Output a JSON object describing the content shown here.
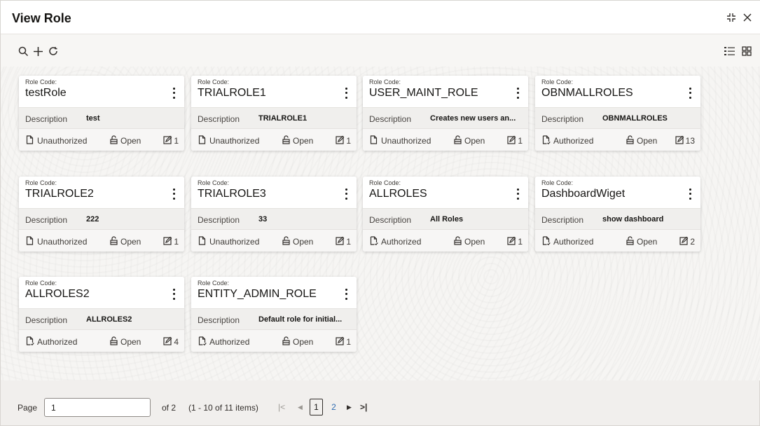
{
  "header": {
    "title": "View Role"
  },
  "toolbar": {},
  "cards": [
    {
      "rc_label": "Role Code:",
      "code": "testRole",
      "desc_label": "Description",
      "desc": "test",
      "status": "Unauthorized",
      "lock": "Open",
      "count": "1"
    },
    {
      "rc_label": "Role Code:",
      "code": "TRIALROLE1",
      "desc_label": "Description",
      "desc": "TRIALROLE1",
      "status": "Unauthorized",
      "lock": "Open",
      "count": "1"
    },
    {
      "rc_label": "Role Code:",
      "code": "USER_MAINT_ROLE",
      "desc_label": "Description",
      "desc": "Creates new users an...",
      "status": "Unauthorized",
      "lock": "Open",
      "count": "1"
    },
    {
      "rc_label": "Role Code:",
      "code": "OBNMALLROLES",
      "desc_label": "Description",
      "desc": "OBNMALLROLES",
      "status": "Authorized",
      "lock": "Open",
      "count": "13"
    },
    {
      "rc_label": "Role Code:",
      "code": "TRIALROLE2",
      "desc_label": "Description",
      "desc": "222",
      "status": "Unauthorized",
      "lock": "Open",
      "count": "1"
    },
    {
      "rc_label": "Role Code:",
      "code": "TRIALROLE3",
      "desc_label": "Description",
      "desc": "33",
      "status": "Unauthorized",
      "lock": "Open",
      "count": "1"
    },
    {
      "rc_label": "Role Code:",
      "code": "ALLROLES",
      "desc_label": "Description",
      "desc": "All Roles",
      "status": "Authorized",
      "lock": "Open",
      "count": "1"
    },
    {
      "rc_label": "Role Code:",
      "code": "DashboardWiget",
      "desc_label": "Description",
      "desc": "show dashboard",
      "status": "Authorized",
      "lock": "Open",
      "count": "2"
    },
    {
      "rc_label": "Role Code:",
      "code": "ALLROLES2",
      "desc_label": "Description",
      "desc": "ALLROLES2",
      "status": "Authorized",
      "lock": "Open",
      "count": "4"
    },
    {
      "rc_label": "Role Code:",
      "code": "ENTITY_ADMIN_ROLE",
      "desc_label": "Description",
      "desc": "Default role for initial...",
      "status": "Authorized",
      "lock": "Open",
      "count": "1"
    }
  ],
  "pager": {
    "label": "Page",
    "current": "1",
    "of": "of 2",
    "range": "(1 - 10 of 11 items)",
    "pages": [
      "1",
      "2"
    ]
  }
}
